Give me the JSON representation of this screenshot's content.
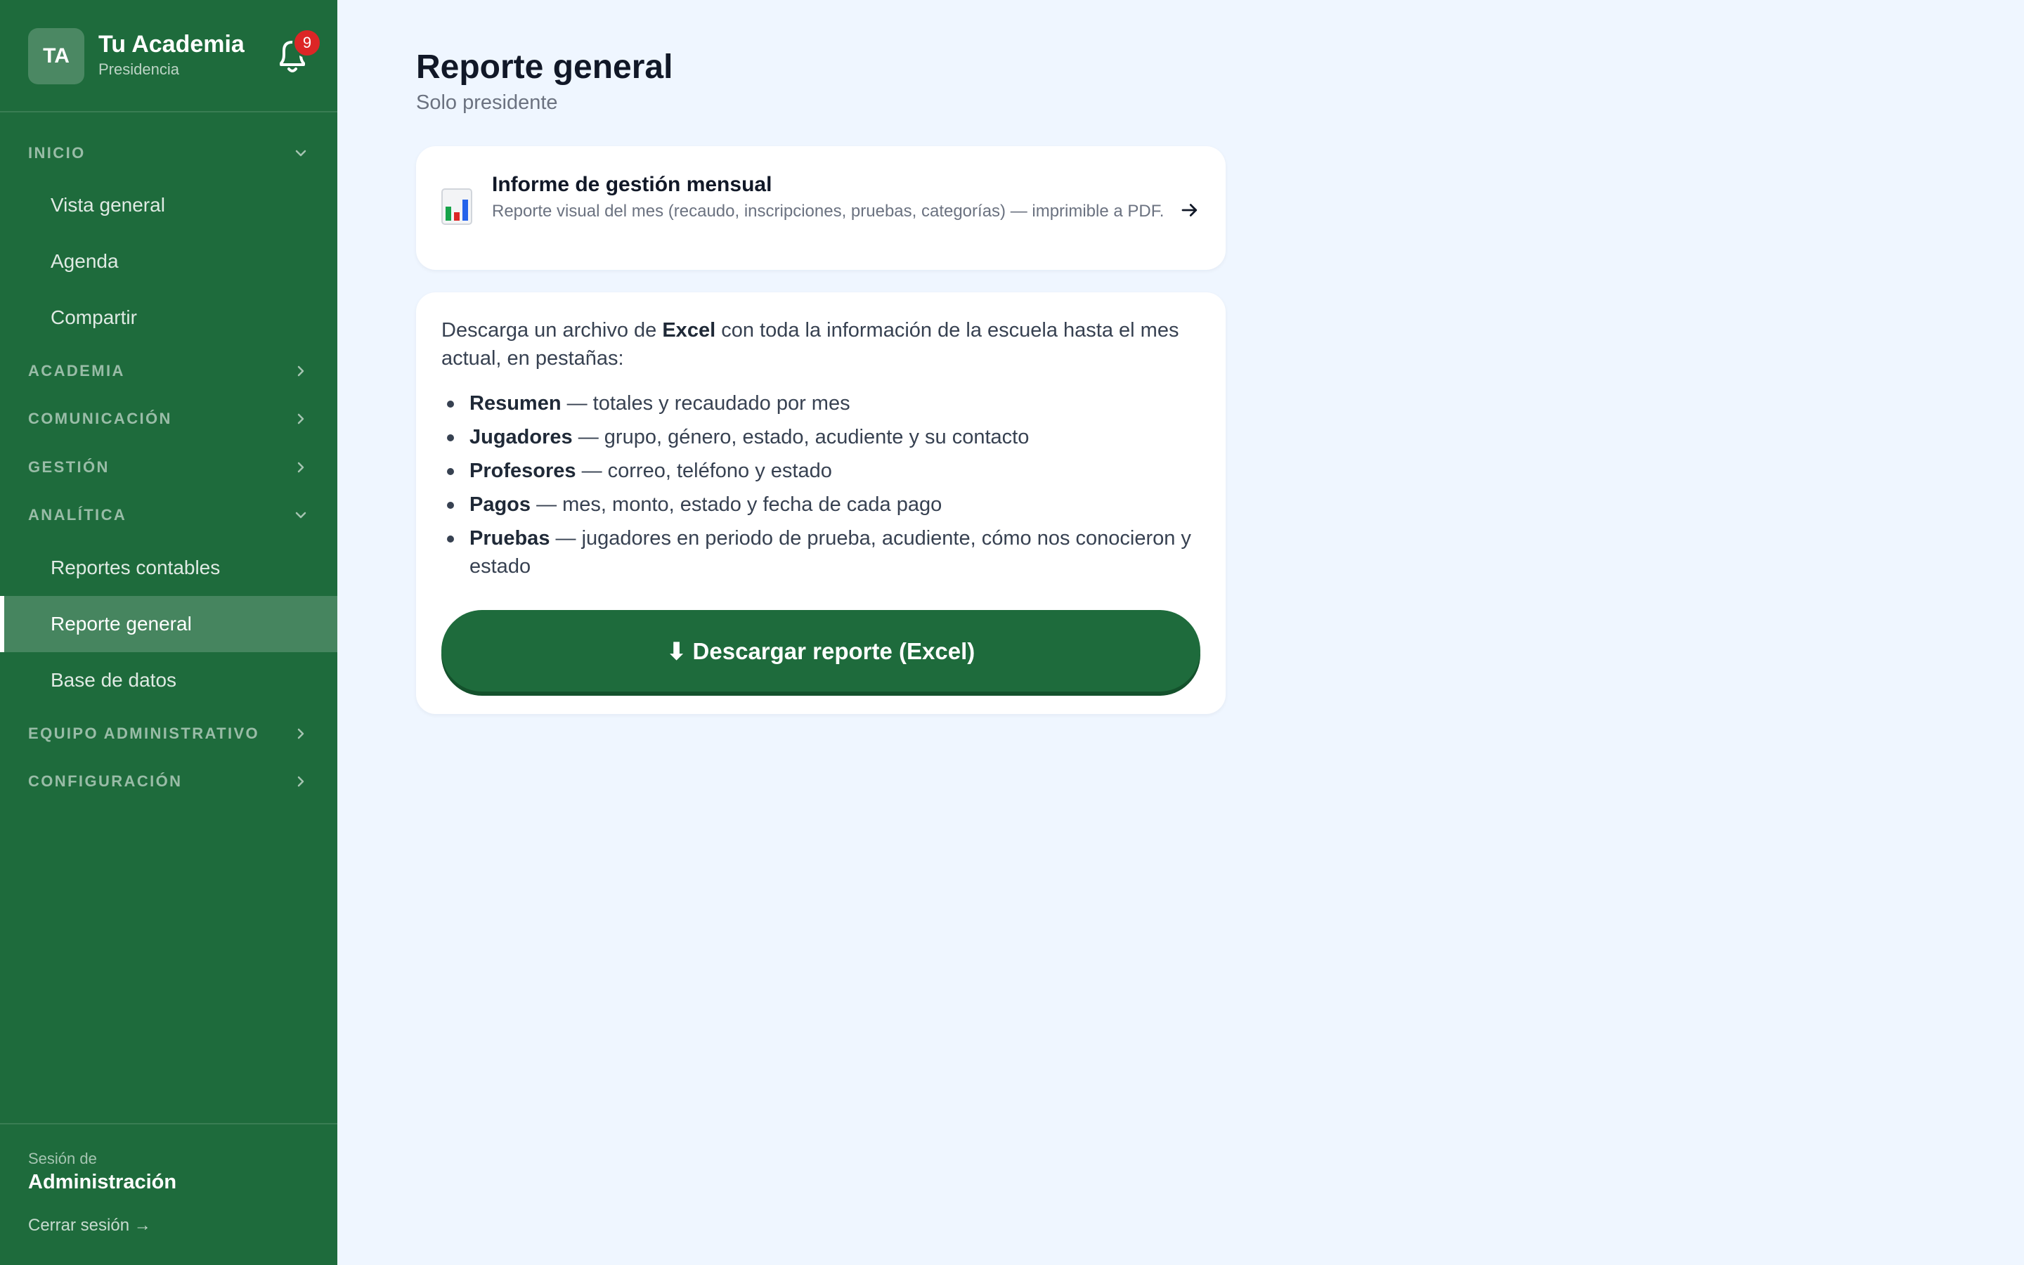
{
  "brand": {
    "initials": "TA",
    "name": "Tu Academia",
    "role": "Presidencia"
  },
  "notifications": {
    "count": "9"
  },
  "sidebar": {
    "sections": [
      {
        "label": "INICIO",
        "expanded": true,
        "items": [
          "Vista general",
          "Agenda",
          "Compartir"
        ]
      },
      {
        "label": "ACADEMIA",
        "expanded": false
      },
      {
        "label": "COMUNICACIÓN",
        "expanded": false
      },
      {
        "label": "GESTIÓN",
        "expanded": false
      },
      {
        "label": "ANALÍTICA",
        "expanded": true,
        "items": [
          "Reportes contables",
          "Reporte general",
          "Base de datos"
        ],
        "active": "Reporte general"
      },
      {
        "label": "EQUIPO ADMINISTRATIVO",
        "expanded": false
      },
      {
        "label": "CONFIGURACIÓN",
        "expanded": false
      }
    ],
    "session_caption": "Sesión de",
    "session_name": "Administración",
    "logout": "Cerrar sesión →"
  },
  "main": {
    "title": "Reporte general",
    "subtitle": "Solo presidente",
    "report_link": {
      "title": "Informe de gestión mensual",
      "description": "Reporte visual del mes (recaudo, inscripciones, pruebas, categorías) — imprimible a PDF."
    },
    "download": {
      "intro_before": "Descarga un archivo de ",
      "intro_bold": "Excel",
      "intro_after": " con toda la información de la escuela hasta el mes actual, en pestañas:",
      "tabs": [
        {
          "name": "Resumen",
          "desc": " — totales y recaudado por mes"
        },
        {
          "name": "Jugadores",
          "desc": " — grupo, género, estado, acudiente y su contacto"
        },
        {
          "name": "Profesores",
          "desc": " — correo, teléfono y estado"
        },
        {
          "name": "Pagos",
          "desc": " — mes, monto, estado y fecha de cada pago"
        },
        {
          "name": "Pruebas",
          "desc": " — jugadores en periodo de prueba, acudiente, cómo nos conocieron y estado"
        }
      ],
      "button_label": "⬇ Descargar reporte (Excel)"
    }
  },
  "colors": {
    "sidebar": "#1e6b3c",
    "background": "#eff6ff",
    "badge": "#dc2626"
  }
}
